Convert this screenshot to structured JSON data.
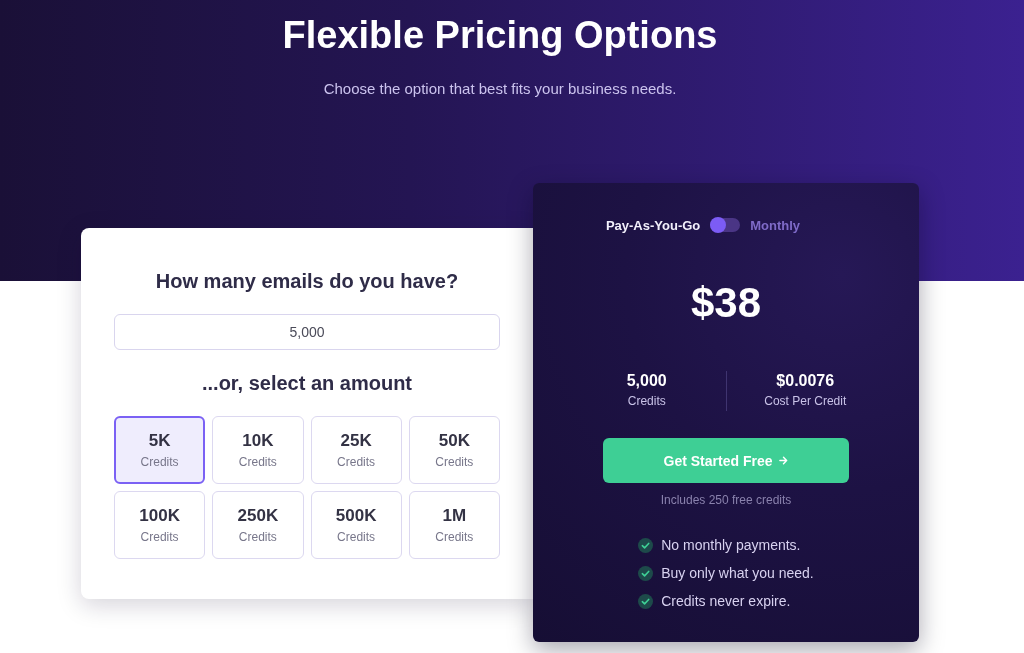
{
  "hero": {
    "title": "Flexible Pricing Options",
    "subtitle": "Choose the option that best fits your business needs."
  },
  "calculator": {
    "question": "How many emails do you have?",
    "email_count": {
      "value": "5,000"
    },
    "select_heading": "...or, select an amount",
    "amounts": [
      {
        "amount": "5K",
        "unit": "Credits",
        "selected": true
      },
      {
        "amount": "10K",
        "unit": "Credits",
        "selected": false
      },
      {
        "amount": "25K",
        "unit": "Credits",
        "selected": false
      },
      {
        "amount": "50K",
        "unit": "Credits",
        "selected": false
      },
      {
        "amount": "100K",
        "unit": "Credits",
        "selected": false
      },
      {
        "amount": "250K",
        "unit": "Credits",
        "selected": false
      },
      {
        "amount": "500K",
        "unit": "Credits",
        "selected": false
      },
      {
        "amount": "1M",
        "unit": "Credits",
        "selected": false
      }
    ]
  },
  "pricing": {
    "billing_options": [
      {
        "label": "Pay-As-You-Go",
        "selected": true
      },
      {
        "label": "Monthly",
        "selected": false
      }
    ],
    "price": "$38",
    "stats": [
      {
        "value": "5,000",
        "label": "Credits"
      },
      {
        "value": "$0.0076",
        "label": "Cost Per Credit"
      }
    ],
    "cta": {
      "label": "Get Started Free"
    },
    "note": "Includes 250 free credits",
    "features": [
      "No monthly payments.",
      "Buy only what you need.",
      "Credits never expire."
    ]
  }
}
